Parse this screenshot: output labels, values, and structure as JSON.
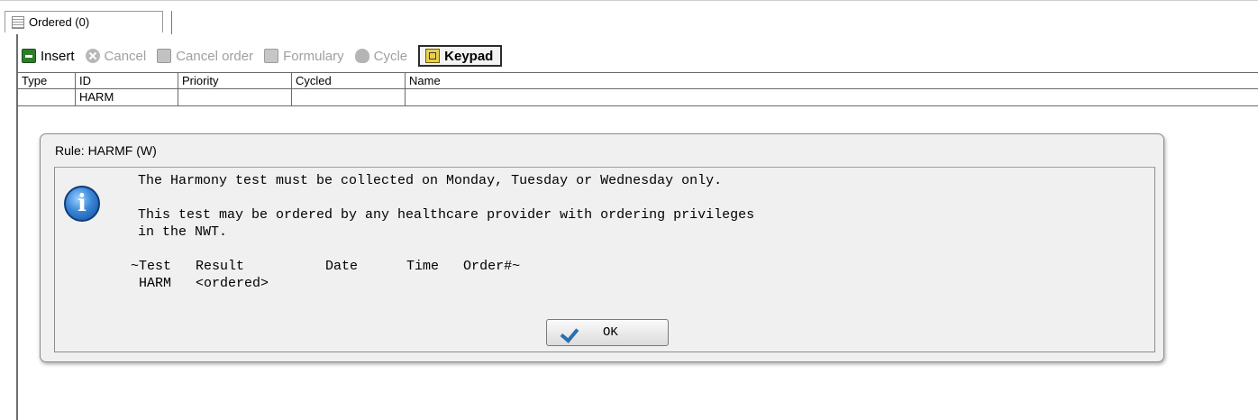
{
  "tab": {
    "label": "Ordered (0)"
  },
  "toolbar": {
    "insert_label": "Insert",
    "cancel_label": "Cancel",
    "cancel_order_label": "Cancel order",
    "formulary_label": "Formulary",
    "cycle_label": "Cycle",
    "keypad_label": "Keypad"
  },
  "table": {
    "columns": [
      "Type",
      "ID",
      "Priority",
      "Cycled",
      "Name"
    ],
    "rows": [
      {
        "type": "",
        "id": "HARM",
        "priority": "",
        "cycled": "",
        "name": ""
      }
    ]
  },
  "dialog": {
    "title": "Rule: HARMF (W)",
    "line1": "The Harmony test must be collected on Monday, Tuesday or Wednesday only.",
    "line2": "This test may be ordered by any healthcare provider with ordering privileges",
    "line3": "in the NWT.",
    "result_header": "~Test   Result          Date      Time   Order#~",
    "result_row": " HARM   <ordered>",
    "ok_label": "OK",
    "icon": "info-icon"
  }
}
